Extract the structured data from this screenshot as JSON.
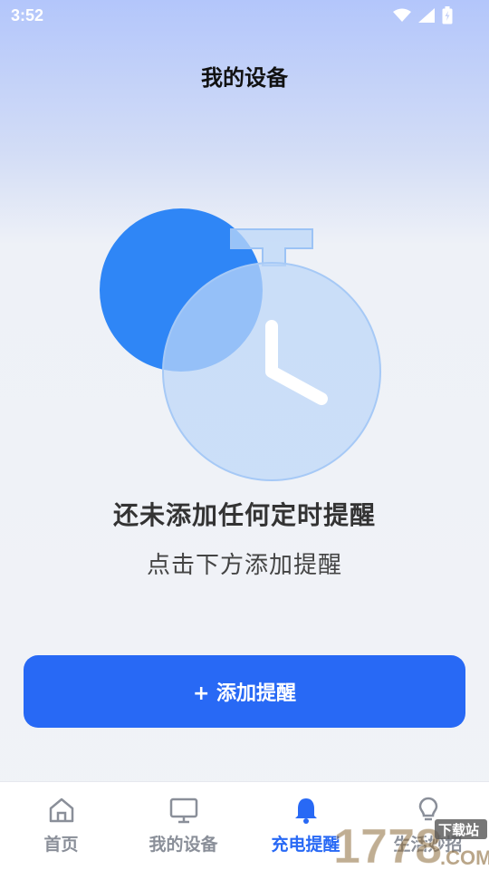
{
  "status_bar": {
    "time": "3:52"
  },
  "header": {
    "title": "我的设备"
  },
  "empty_state": {
    "title": "还未添加任何定时提醒",
    "subtitle": "点击下方添加提醒"
  },
  "add_button": {
    "label": "+ 添加提醒"
  },
  "bottom_nav": {
    "items": [
      {
        "label": "首页",
        "icon": "home-icon",
        "active": false
      },
      {
        "label": "我的设备",
        "icon": "monitor-icon",
        "active": false
      },
      {
        "label": "充电提醒",
        "icon": "bell-icon",
        "active": true
      },
      {
        "label": "生活妙招",
        "icon": "lightbulb-icon",
        "active": false
      }
    ]
  },
  "watermark": {
    "text": "1778",
    "tag": "下载站",
    "suffix": ".COM"
  },
  "colors": {
    "accent": "#2869f5",
    "nav_inactive": "#8a8f99",
    "circle_blue": "#2f86f6",
    "clock_light": "#bcd7f8"
  }
}
